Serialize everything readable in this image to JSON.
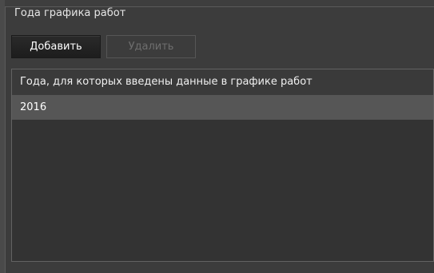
{
  "group": {
    "title": "Года графика работ"
  },
  "toolbar": {
    "add_label": "Добавить",
    "delete_label": "Удалить"
  },
  "table": {
    "header": "Года, для которых введены данные в графике работ",
    "rows": [
      {
        "year": "2016"
      }
    ]
  }
}
